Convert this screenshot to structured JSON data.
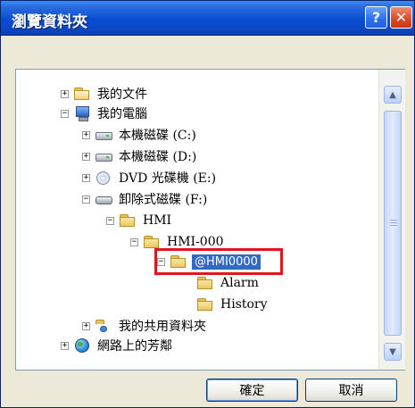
{
  "window": {
    "title": "瀏覽資料夾",
    "help_label": "?",
    "close_label": "✕"
  },
  "tree": {
    "items": [
      {
        "label": "我的文件",
        "expander": "+",
        "icon": "documents-folder-icon"
      },
      {
        "label": "我的電腦",
        "expander": "−",
        "icon": "computer-icon"
      },
      {
        "label": "本機磁碟 (C:)",
        "expander": "+",
        "icon": "local-drive-icon"
      },
      {
        "label": "本機磁碟 (D:)",
        "expander": "+",
        "icon": "local-drive-icon"
      },
      {
        "label": "DVD 光碟機 (E:)",
        "expander": "+",
        "icon": "dvd-drive-icon"
      },
      {
        "label": "卸除式磁碟 (F:)",
        "expander": "−",
        "icon": "removable-drive-icon"
      },
      {
        "label": "HMI",
        "expander": "−",
        "icon": "folder-icon"
      },
      {
        "label": "HMI-000",
        "expander": "−",
        "icon": "folder-icon"
      },
      {
        "label": "@HMI0000",
        "expander": "−",
        "icon": "folder-icon",
        "selected": true
      },
      {
        "label": "Alarm",
        "expander": "",
        "icon": "folder-icon"
      },
      {
        "label": "History",
        "expander": "",
        "icon": "folder-icon"
      },
      {
        "label": "我的共用資料夾",
        "expander": "+",
        "icon": "shared-folder-icon"
      },
      {
        "label": "網路上的芳鄰",
        "expander": "+",
        "icon": "network-icon"
      }
    ]
  },
  "scrollbar": {
    "up_arrow": "▲",
    "down_arrow": "▼"
  },
  "buttons": {
    "ok_label": "確定",
    "cancel_label": "取消"
  },
  "colors": {
    "titlebar": "#0A4CD0",
    "selection": "#316AC5",
    "highlight_box": "#E3141B"
  }
}
